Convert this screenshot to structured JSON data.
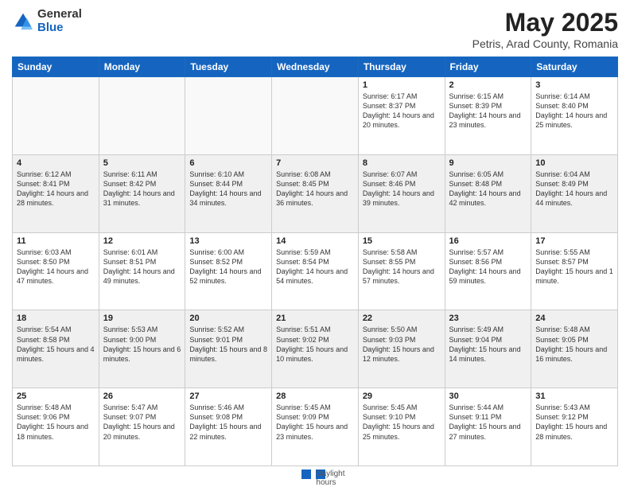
{
  "header": {
    "logo_general": "General",
    "logo_blue": "Blue",
    "main_title": "May 2025",
    "subtitle": "Petris, Arad County, Romania"
  },
  "days_of_week": [
    "Sunday",
    "Monday",
    "Tuesday",
    "Wednesday",
    "Thursday",
    "Friday",
    "Saturday"
  ],
  "weeks": [
    [
      {
        "num": "",
        "info": "",
        "empty": true
      },
      {
        "num": "",
        "info": "",
        "empty": true
      },
      {
        "num": "",
        "info": "",
        "empty": true
      },
      {
        "num": "",
        "info": "",
        "empty": true
      },
      {
        "num": "1",
        "info": "Sunrise: 6:17 AM\nSunset: 8:37 PM\nDaylight: 14 hours\nand 20 minutes."
      },
      {
        "num": "2",
        "info": "Sunrise: 6:15 AM\nSunset: 8:39 PM\nDaylight: 14 hours\nand 23 minutes."
      },
      {
        "num": "3",
        "info": "Sunrise: 6:14 AM\nSunset: 8:40 PM\nDaylight: 14 hours\nand 25 minutes."
      }
    ],
    [
      {
        "num": "4",
        "info": "Sunrise: 6:12 AM\nSunset: 8:41 PM\nDaylight: 14 hours\nand 28 minutes.",
        "shade": true
      },
      {
        "num": "5",
        "info": "Sunrise: 6:11 AM\nSunset: 8:42 PM\nDaylight: 14 hours\nand 31 minutes.",
        "shade": true
      },
      {
        "num": "6",
        "info": "Sunrise: 6:10 AM\nSunset: 8:44 PM\nDaylight: 14 hours\nand 34 minutes.",
        "shade": true
      },
      {
        "num": "7",
        "info": "Sunrise: 6:08 AM\nSunset: 8:45 PM\nDaylight: 14 hours\nand 36 minutes.",
        "shade": true
      },
      {
        "num": "8",
        "info": "Sunrise: 6:07 AM\nSunset: 8:46 PM\nDaylight: 14 hours\nand 39 minutes.",
        "shade": true
      },
      {
        "num": "9",
        "info": "Sunrise: 6:05 AM\nSunset: 8:48 PM\nDaylight: 14 hours\nand 42 minutes.",
        "shade": true
      },
      {
        "num": "10",
        "info": "Sunrise: 6:04 AM\nSunset: 8:49 PM\nDaylight: 14 hours\nand 44 minutes.",
        "shade": true
      }
    ],
    [
      {
        "num": "11",
        "info": "Sunrise: 6:03 AM\nSunset: 8:50 PM\nDaylight: 14 hours\nand 47 minutes."
      },
      {
        "num": "12",
        "info": "Sunrise: 6:01 AM\nSunset: 8:51 PM\nDaylight: 14 hours\nand 49 minutes."
      },
      {
        "num": "13",
        "info": "Sunrise: 6:00 AM\nSunset: 8:52 PM\nDaylight: 14 hours\nand 52 minutes."
      },
      {
        "num": "14",
        "info": "Sunrise: 5:59 AM\nSunset: 8:54 PM\nDaylight: 14 hours\nand 54 minutes."
      },
      {
        "num": "15",
        "info": "Sunrise: 5:58 AM\nSunset: 8:55 PM\nDaylight: 14 hours\nand 57 minutes."
      },
      {
        "num": "16",
        "info": "Sunrise: 5:57 AM\nSunset: 8:56 PM\nDaylight: 14 hours\nand 59 minutes."
      },
      {
        "num": "17",
        "info": "Sunrise: 5:55 AM\nSunset: 8:57 PM\nDaylight: 15 hours\nand 1 minute."
      }
    ],
    [
      {
        "num": "18",
        "info": "Sunrise: 5:54 AM\nSunset: 8:58 PM\nDaylight: 15 hours\nand 4 minutes.",
        "shade": true
      },
      {
        "num": "19",
        "info": "Sunrise: 5:53 AM\nSunset: 9:00 PM\nDaylight: 15 hours\nand 6 minutes.",
        "shade": true
      },
      {
        "num": "20",
        "info": "Sunrise: 5:52 AM\nSunset: 9:01 PM\nDaylight: 15 hours\nand 8 minutes.",
        "shade": true
      },
      {
        "num": "21",
        "info": "Sunrise: 5:51 AM\nSunset: 9:02 PM\nDaylight: 15 hours\nand 10 minutes.",
        "shade": true
      },
      {
        "num": "22",
        "info": "Sunrise: 5:50 AM\nSunset: 9:03 PM\nDaylight: 15 hours\nand 12 minutes.",
        "shade": true
      },
      {
        "num": "23",
        "info": "Sunrise: 5:49 AM\nSunset: 9:04 PM\nDaylight: 15 hours\nand 14 minutes.",
        "shade": true
      },
      {
        "num": "24",
        "info": "Sunrise: 5:48 AM\nSunset: 9:05 PM\nDaylight: 15 hours\nand 16 minutes.",
        "shade": true
      }
    ],
    [
      {
        "num": "25",
        "info": "Sunrise: 5:48 AM\nSunset: 9:06 PM\nDaylight: 15 hours\nand 18 minutes."
      },
      {
        "num": "26",
        "info": "Sunrise: 5:47 AM\nSunset: 9:07 PM\nDaylight: 15 hours\nand 20 minutes."
      },
      {
        "num": "27",
        "info": "Sunrise: 5:46 AM\nSunset: 9:08 PM\nDaylight: 15 hours\nand 22 minutes."
      },
      {
        "num": "28",
        "info": "Sunrise: 5:45 AM\nSunset: 9:09 PM\nDaylight: 15 hours\nand 23 minutes."
      },
      {
        "num": "29",
        "info": "Sunrise: 5:45 AM\nSunset: 9:10 PM\nDaylight: 15 hours\nand 25 minutes."
      },
      {
        "num": "30",
        "info": "Sunrise: 5:44 AM\nSunset: 9:11 PM\nDaylight: 15 hours\nand 27 minutes."
      },
      {
        "num": "31",
        "info": "Sunrise: 5:43 AM\nSunset: 9:12 PM\nDaylight: 15 hours\nand 28 minutes."
      }
    ]
  ],
  "footer": {
    "note": "Daylight hours"
  }
}
